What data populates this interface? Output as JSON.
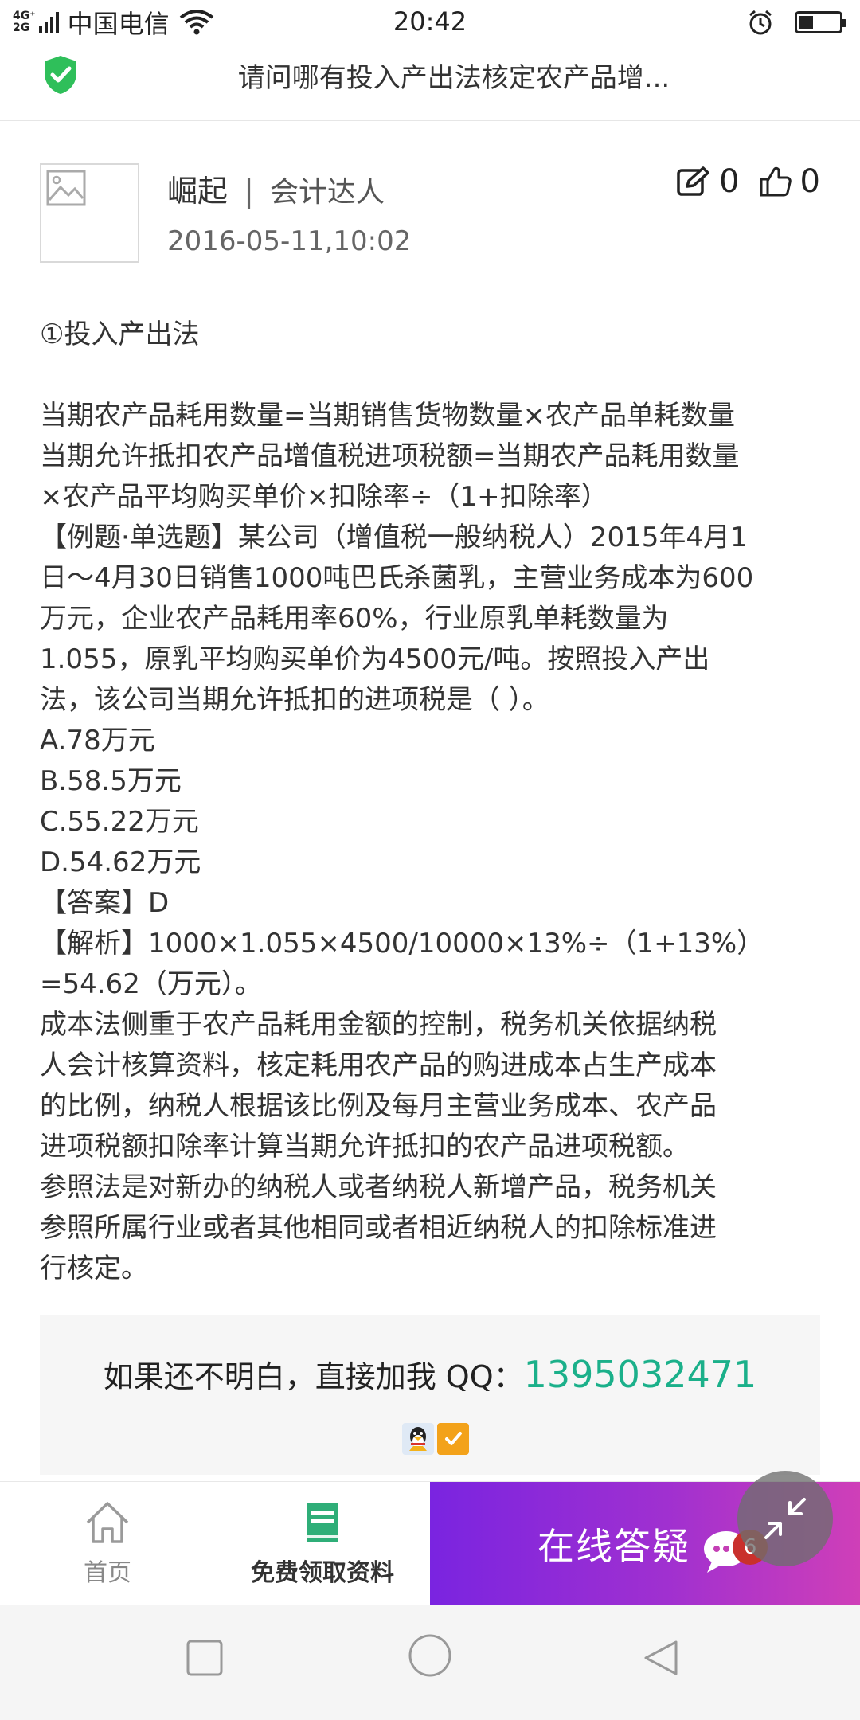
{
  "status_bar": {
    "network_types": [
      "4G⁺",
      "2G"
    ],
    "carrier": "中国电信",
    "time": "20:42",
    "battery_level": 0.35
  },
  "title_bar": {
    "title": "请问哪有投入产出法核定农产品增..."
  },
  "post": {
    "author": "崛起",
    "separator": "|",
    "author_title": "会计达人",
    "date": "2016-05-11,10:02",
    "comment_count": "0",
    "like_count": "0"
  },
  "article": {
    "heading": "①投入产出法",
    "lines": [
      "当期农产品耗用数量=当期销售货物数量×农产品单耗数量",
      "当期允许抵扣农产品增值税进项税额=当期农产品耗用数量",
      "×农产品平均购买单价×扣除率÷（1+扣除率）",
      "【例题·单选题】某公司（增值税一般纳税人）2015年4月1",
      "日～4月30日销售1000吨巴氏杀菌乳，主营业务成本为600",
      "万元，企业农产品耗用率60%，行业原乳单耗数量为",
      "1.055，原乳平均购买单价为4500元/吨。按照投入产出",
      "法，该公司当期允许抵扣的进项税是（ ）。",
      "A.78万元",
      "B.58.5万元",
      "C.55.22万元",
      "D.54.62万元",
      "【答案】D",
      "【解析】1000×1.055×4500/10000×13%÷（1+13%）",
      "=54.62（万元）。",
      "成本法侧重于农产品耗用金额的控制，税务机关依据纳税",
      "人会计核算资料，核定耗用农产品的购进成本占生产成本",
      "的比例，纳税人根据该比例及每月主营业务成本、农产品",
      "进项税额扣除率计算当期允许抵扣的农产品进项税额。",
      "参照法是对新办的纳税人或者纳税人新增产品，税务机关",
      "参照所属行业或者其他相同或者相近纳税人的扣除标准进",
      "行核定。"
    ]
  },
  "qq_box": {
    "prompt": "如果还不明白，直接加我 QQ：",
    "number": "1395032471"
  },
  "tab_bar": {
    "home_label": "首页",
    "material_label": "免费领取资料",
    "online_label": "在线答疑",
    "badge_count": "6"
  },
  "colors": {
    "accent_green": "#1bb08a",
    "gradient_start": "#7a24e0",
    "gradient_end": "#cf3fb8",
    "shield_green": "#2fbf5a",
    "book_green": "#2fae78",
    "badge_red": "#c9302c"
  }
}
